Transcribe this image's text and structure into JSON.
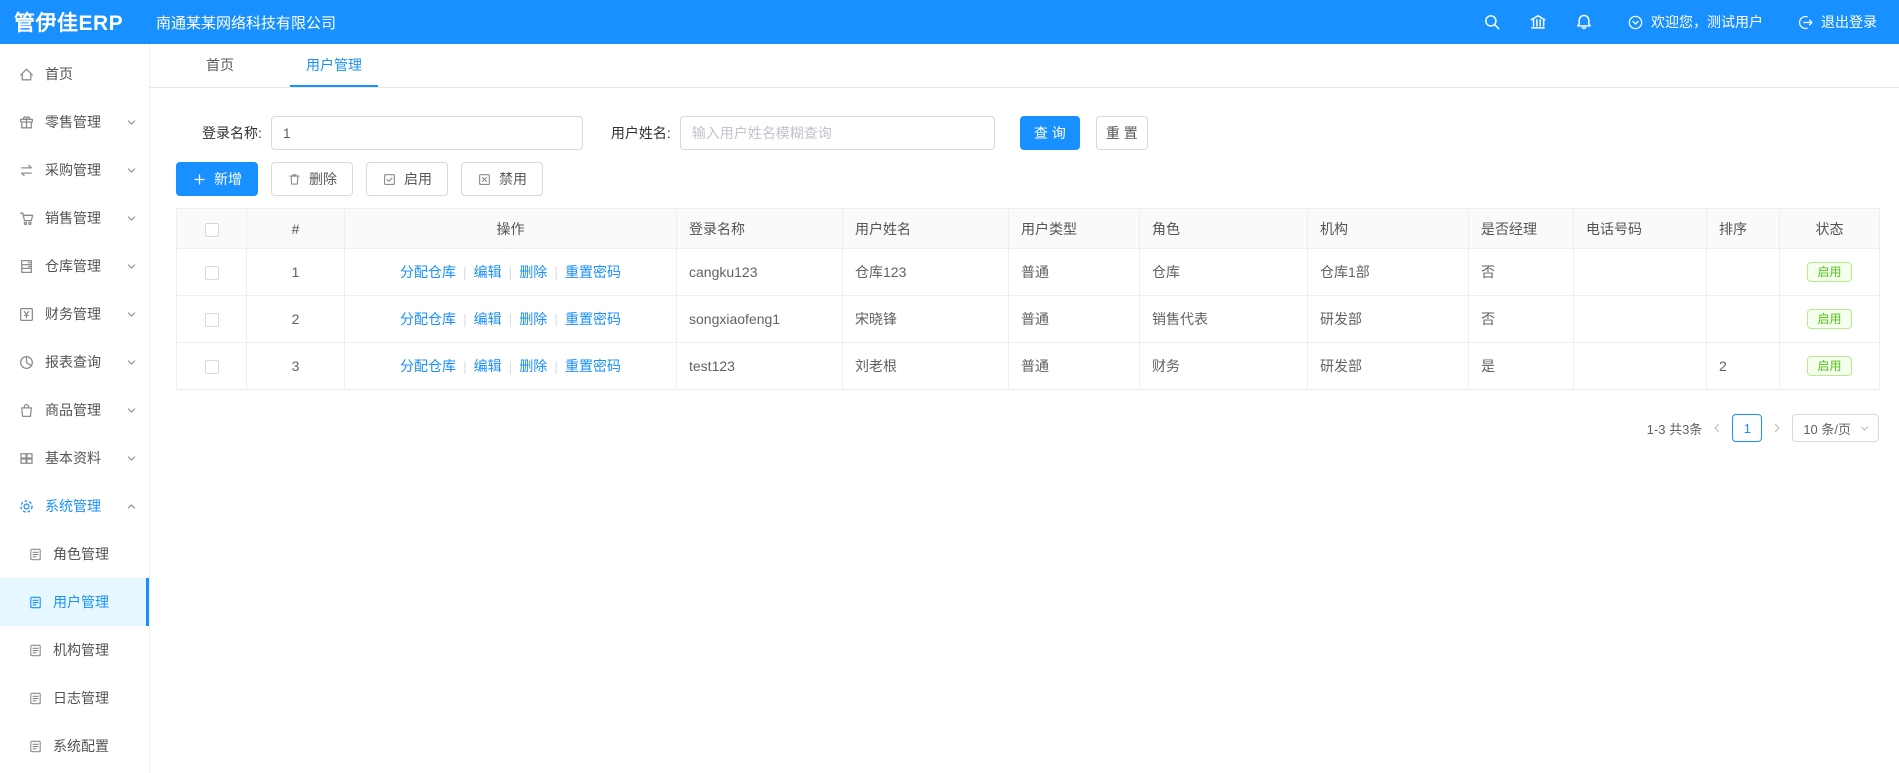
{
  "colors": {
    "primary": "#1890ff",
    "success": "#52c41a"
  },
  "header": {
    "logo": "管伊佳ERP",
    "company": "南通某某网络科技有限公司",
    "welcome": "欢迎您，测试用户",
    "logout_label": "退出登录"
  },
  "sidebar": {
    "items": [
      {
        "label": "首页"
      },
      {
        "label": "零售管理"
      },
      {
        "label": "采购管理"
      },
      {
        "label": "销售管理"
      },
      {
        "label": "仓库管理"
      },
      {
        "label": "财务管理"
      },
      {
        "label": "报表查询"
      },
      {
        "label": "商品管理"
      },
      {
        "label": "基本资料"
      },
      {
        "label": "系统管理"
      }
    ],
    "system_subitems": [
      {
        "label": "角色管理"
      },
      {
        "label": "用户管理"
      },
      {
        "label": "机构管理"
      },
      {
        "label": "日志管理"
      },
      {
        "label": "系统配置"
      }
    ]
  },
  "tabs": [
    {
      "label": "首页"
    },
    {
      "label": "用户管理"
    }
  ],
  "filters": {
    "login_name_label": "登录名称:",
    "login_name_value": "1",
    "user_name_label": "用户姓名:",
    "user_name_placeholder": "输入用户姓名模糊查询",
    "search_label": "查 询",
    "reset_label": "重 置"
  },
  "toolbar": {
    "add_label": "新增",
    "delete_label": "删除",
    "enable_label": "启用",
    "disable_label": "禁用"
  },
  "table": {
    "columns": [
      "#",
      "操作",
      "登录名称",
      "用户姓名",
      "用户类型",
      "角色",
      "机构",
      "是否经理",
      "电话号码",
      "排序",
      "状态"
    ],
    "action_links": [
      "分配仓库",
      "编辑",
      "删除",
      "重置密码"
    ],
    "rows": [
      {
        "index": "1",
        "login": "cangku123",
        "name": "仓库123",
        "type": "普通",
        "role": "仓库",
        "org": "仓库1部",
        "manager": "否",
        "phone": "",
        "sort": "",
        "status": "启用"
      },
      {
        "index": "2",
        "login": "songxiaofeng1",
        "name": "宋晓锋",
        "type": "普通",
        "role": "销售代表",
        "org": "研发部",
        "manager": "否",
        "phone": "",
        "sort": "",
        "status": "启用"
      },
      {
        "index": "3",
        "login": "test123",
        "name": "刘老根",
        "type": "普通",
        "role": "财务",
        "org": "研发部",
        "manager": "是",
        "phone": "",
        "sort": "2",
        "status": "启用"
      }
    ]
  },
  "pagination": {
    "range_text": "1-3 共3条",
    "current_page": "1",
    "page_size": "10 条/页"
  }
}
